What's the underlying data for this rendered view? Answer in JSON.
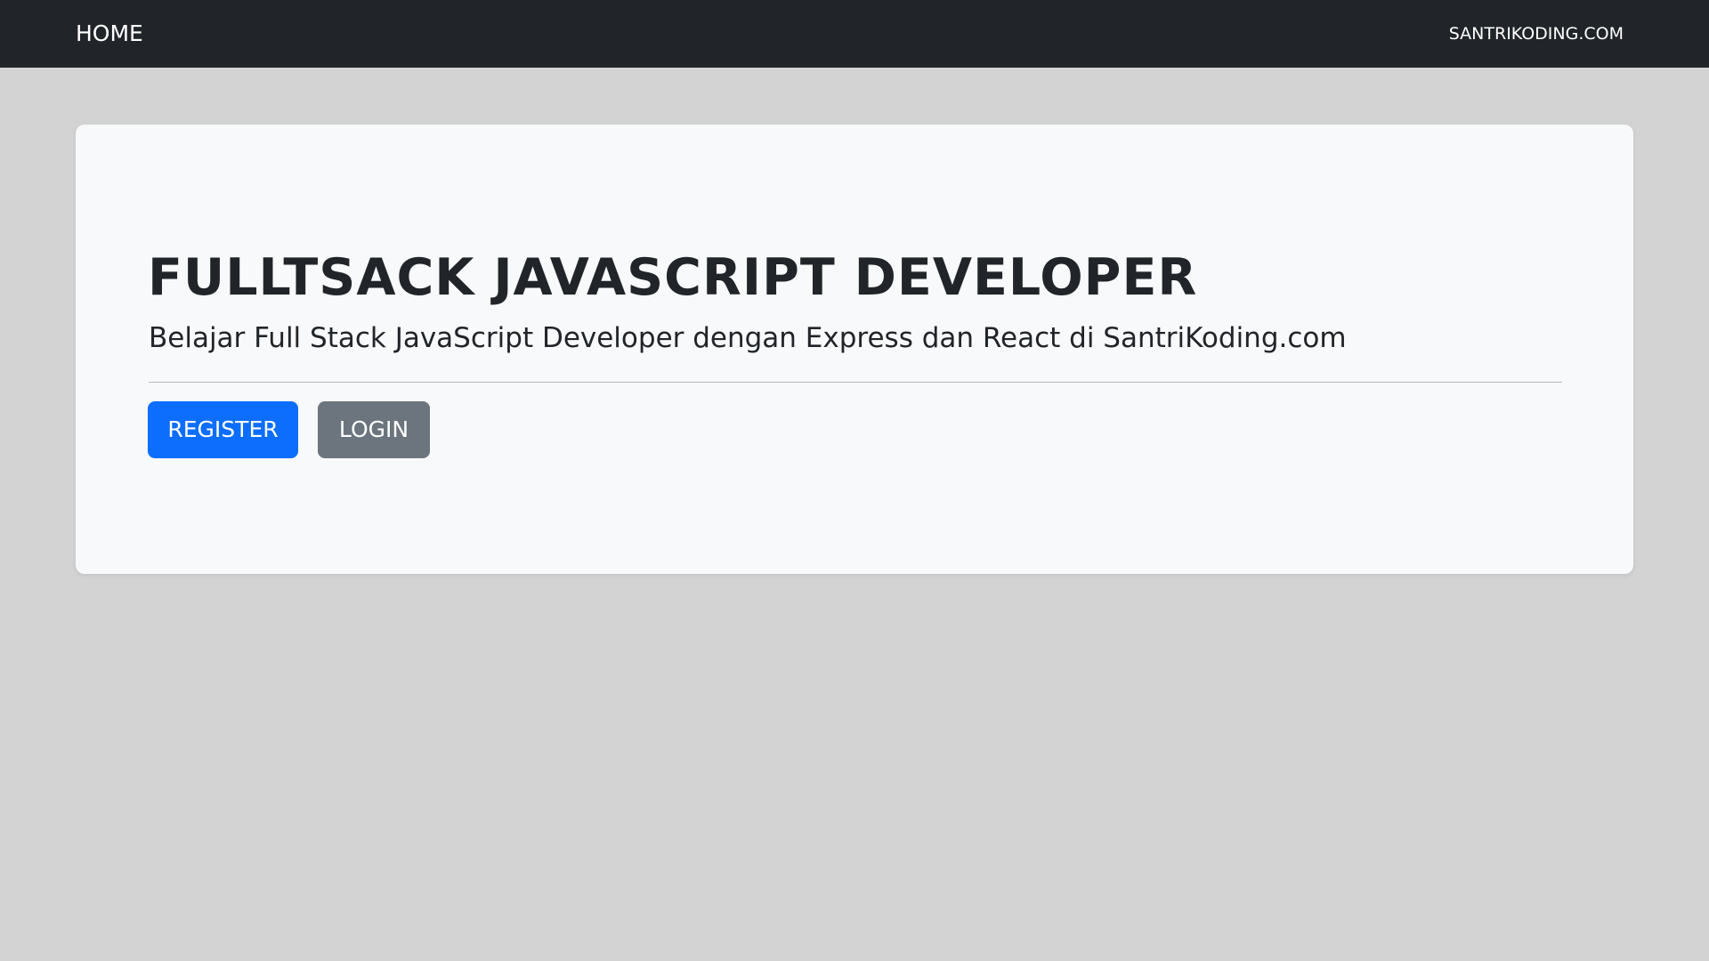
{
  "navbar": {
    "home_label": "HOME",
    "brand_label": "SANTRIKODING.COM",
    "background": "#212529"
  },
  "hero": {
    "title": "FULLTSACK JAVASCRIPT DEVELOPER",
    "lead": "Belajar Full Stack JavaScript Developer dengan Express dan React di SantriKoding.com",
    "register_label": "REGISTER",
    "login_label": "LOGIN"
  },
  "colors": {
    "page_background": "#d3d3d3",
    "card_background": "#f8f9fa",
    "primary": "#0d6efd",
    "secondary": "#6c757d"
  }
}
